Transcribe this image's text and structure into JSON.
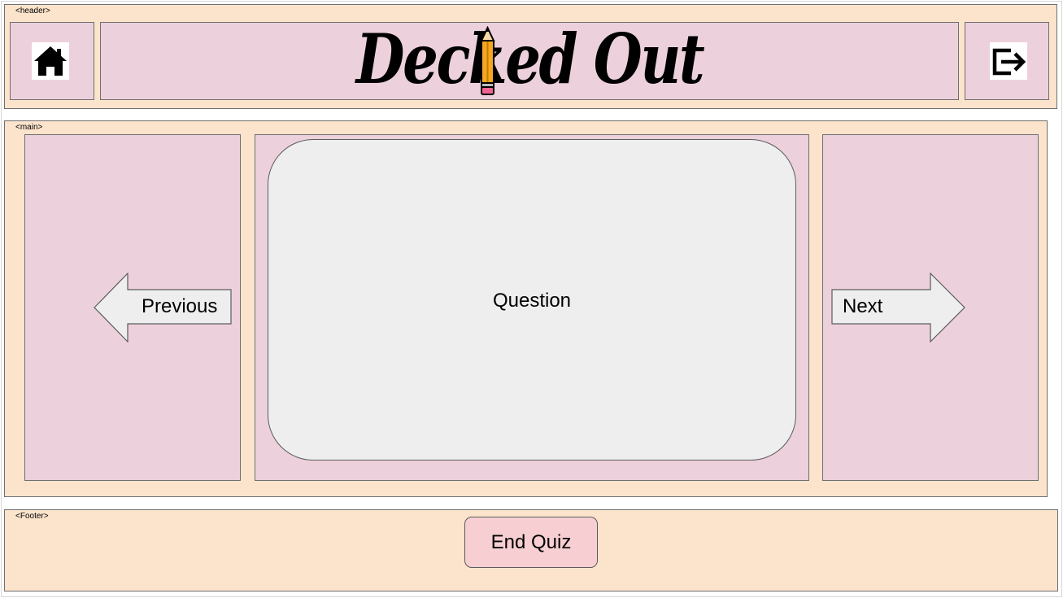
{
  "header": {
    "tag": "<header>",
    "logo_text": "Decked Out",
    "home_icon": "home-icon",
    "logout_icon": "logout-icon"
  },
  "main": {
    "tag": "<main>",
    "previous_label": "Previous",
    "question_label": "Question",
    "next_label": "Next"
  },
  "footer": {
    "tag": "<Footer>",
    "end_quiz_label": "End Quiz"
  },
  "colors": {
    "region_bg": "#fce4cc",
    "panel_bg": "#ecd1dc",
    "card_bg": "#eeeeee",
    "end_quiz_bg": "#f7cfd3"
  }
}
